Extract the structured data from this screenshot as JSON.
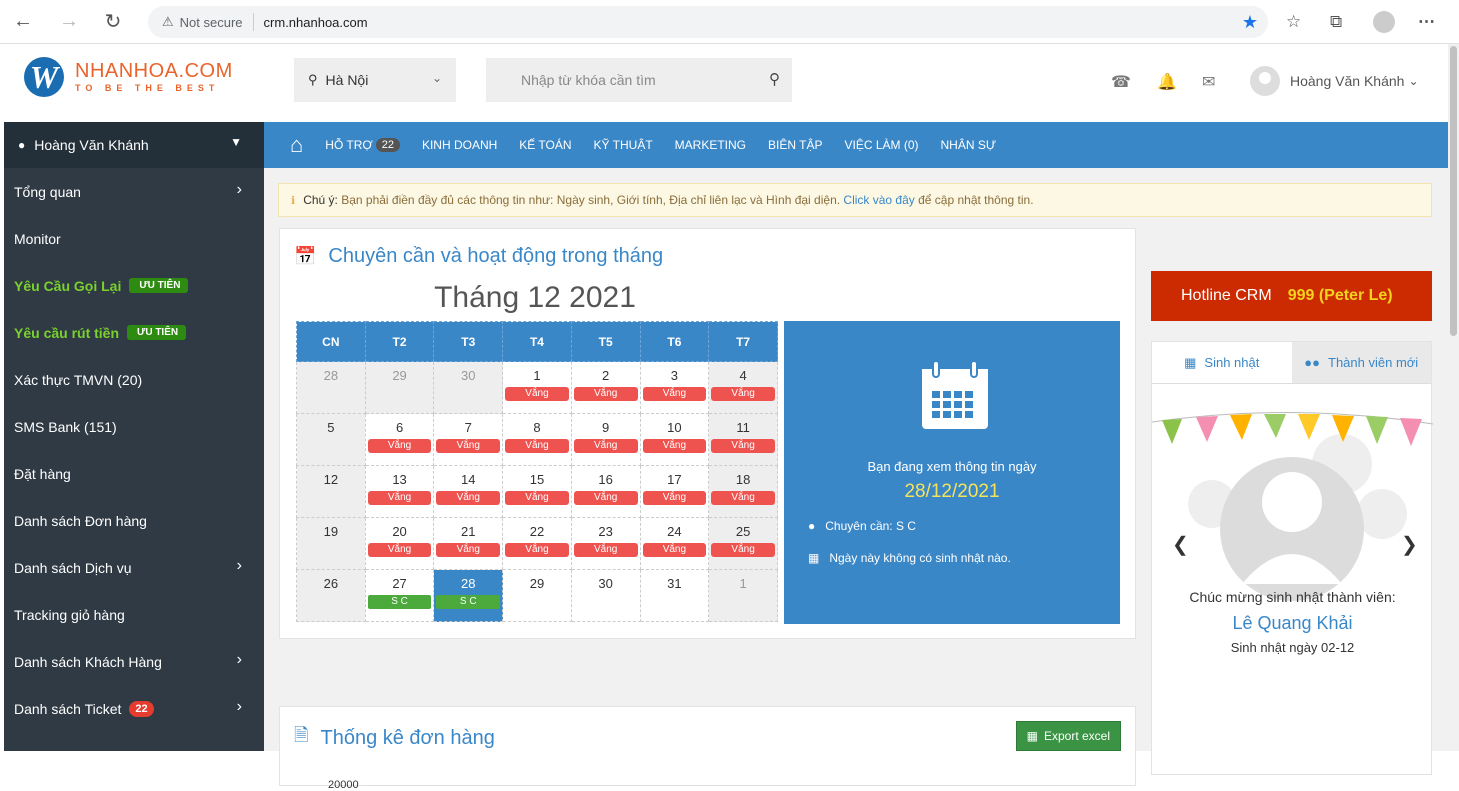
{
  "browser": {
    "security_label": "Not secure",
    "url": "crm.nhanhoa.com"
  },
  "header": {
    "logo_name": "NHANHOA.COM",
    "logo_tagline": "TO BE THE BEST",
    "location": "Hà Nội",
    "search_placeholder": "Nhập từ khóa cần tìm",
    "user_name": "Hoàng Văn Khánh"
  },
  "sidebar": {
    "user": "Hoàng Văn Khánh",
    "items": [
      {
        "label": "Tổng quan",
        "arrow": true
      },
      {
        "label": "Monitor"
      },
      {
        "label": "Yêu Cầu Gọi Lại",
        "badge": "ƯU TIÊN",
        "green": true
      },
      {
        "label": "Yêu cầu rút tiền",
        "badge": "ƯU TIÊN",
        "green": true
      },
      {
        "label": "Xác thực TMVN (20)"
      },
      {
        "label": "SMS Bank (151)"
      },
      {
        "label": "Đặt hàng"
      },
      {
        "label": "Danh sách Đơn hàng"
      },
      {
        "label": "Danh sách Dịch vụ",
        "arrow": true
      },
      {
        "label": "Tracking giỏ hàng"
      },
      {
        "label": "Danh sách Khách Hàng",
        "arrow": true
      },
      {
        "label": "Danh sách Ticket",
        "count": "22",
        "arrow": true
      }
    ]
  },
  "topnav": {
    "items": [
      {
        "label": "HỖ TRỢ",
        "badge": "22"
      },
      {
        "label": "KINH DOANH"
      },
      {
        "label": "KẾ TOÁN"
      },
      {
        "label": "KỸ THUẬT"
      },
      {
        "label": "MARKETING"
      },
      {
        "label": "BIÊN TẬP"
      },
      {
        "label": "VIỆC LÀM (0)"
      },
      {
        "label": "NHÂN SỰ"
      }
    ]
  },
  "alert": {
    "prefix": "Chú ý:",
    "text": " Bạn phải điền đầy đủ các thông tin như: Ngày sinh, Giới tính, Địa chỉ liên lạc và Hình đại diện. ",
    "link": "Click vào đây",
    "suffix": " để cập nhật thông tin."
  },
  "attendance": {
    "title": "Chuyên cần và hoạt động trong tháng",
    "month": "Tháng 12 2021",
    "weekdays": [
      "CN",
      "T2",
      "T3",
      "T4",
      "T5",
      "T6",
      "T7"
    ],
    "weeks": [
      [
        {
          "d": "28",
          "g": true
        },
        {
          "d": "29",
          "g": true
        },
        {
          "d": "30",
          "g": true
        },
        {
          "d": "1",
          "t": "Vắng"
        },
        {
          "d": "2",
          "t": "Vắng"
        },
        {
          "d": "3",
          "t": "Vắng"
        },
        {
          "d": "4",
          "t": "Vắng",
          "g": true
        }
      ],
      [
        {
          "d": "5",
          "g": true
        },
        {
          "d": "6",
          "t": "Vắng"
        },
        {
          "d": "7",
          "t": "Vắng"
        },
        {
          "d": "8",
          "t": "Vắng"
        },
        {
          "d": "9",
          "t": "Vắng"
        },
        {
          "d": "10",
          "t": "Vắng"
        },
        {
          "d": "11",
          "t": "Vắng",
          "g": true
        }
      ],
      [
        {
          "d": "12",
          "g": true
        },
        {
          "d": "13",
          "t": "Vắng"
        },
        {
          "d": "14",
          "t": "Vắng"
        },
        {
          "d": "15",
          "t": "Vắng"
        },
        {
          "d": "16",
          "t": "Vắng"
        },
        {
          "d": "17",
          "t": "Vắng"
        },
        {
          "d": "18",
          "t": "Vắng",
          "g": true
        }
      ],
      [
        {
          "d": "19",
          "g": true
        },
        {
          "d": "20",
          "t": "Vắng"
        },
        {
          "d": "21",
          "t": "Vắng"
        },
        {
          "d": "22",
          "t": "Vắng"
        },
        {
          "d": "23",
          "t": "Vắng"
        },
        {
          "d": "24",
          "t": "Vắng"
        },
        {
          "d": "25",
          "t": "Vắng",
          "g": true
        }
      ],
      [
        {
          "d": "26",
          "g": true
        },
        {
          "d": "27",
          "t": "S C",
          "ok": true
        },
        {
          "d": "28",
          "t": "S C",
          "ok": true,
          "sel": true
        },
        {
          "d": "29"
        },
        {
          "d": "30"
        },
        {
          "d": "31"
        },
        {
          "d": "1",
          "g": true
        }
      ]
    ],
    "info_label": "Bạn đang xem thông tin ngày",
    "info_date": "28/12/2021",
    "attendance_label": "Chuyên cần: S C",
    "birthday_label": "Ngày này không có sinh nhật nào."
  },
  "orders": {
    "title": "Thống kê đơn hàng",
    "export_label": "Export excel",
    "ytick": "20000"
  },
  "hotline": {
    "label": "Hotline CRM",
    "number": "999 (Peter Le)"
  },
  "birthday": {
    "tab_birthday": "Sinh nhật",
    "tab_new": "Thành viên mới",
    "message": "Chúc mừng sinh nhật thành viên:",
    "name": "Lê Quang Khải",
    "date": "Sinh nhật ngày 02-12"
  },
  "colors": {
    "primary": "#3a87c8",
    "sidebar": "#2f3a44",
    "hotline": "#cc2a00",
    "absent": "#ef5350",
    "present": "#4caa3c"
  }
}
